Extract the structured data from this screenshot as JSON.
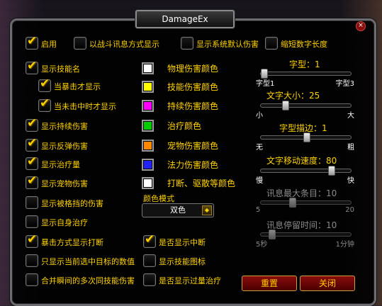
{
  "title": "DamageEx",
  "close_glyph": "×",
  "checkboxes": [
    {
      "label": "启用",
      "checked": true
    },
    {
      "label": "以战斗讯息方式显示",
      "checked": false
    },
    {
      "label": "显示系统默认伤害",
      "checked": false
    },
    {
      "label": "缩短数字长度",
      "checked": false
    },
    {
      "label": "显示技能名",
      "checked": true
    },
    {
      "label": "当暴击才显示",
      "checked": true
    },
    {
      "label": "当未击中时才显示",
      "checked": true
    },
    {
      "label": "显示持续伤害",
      "checked": true
    },
    {
      "label": "显示反弹伤害",
      "checked": true
    },
    {
      "label": "显示治疗量",
      "checked": true
    },
    {
      "label": "显示宠物伤害",
      "checked": true
    },
    {
      "label": "显示被格挡的伤害",
      "checked": false
    },
    {
      "label": "显示自身治疗",
      "checked": false
    },
    {
      "label": "暴击方式显示打断",
      "checked": true
    },
    {
      "label": "是否显示中断",
      "checked": true
    },
    {
      "label": "只显示当前选中目标的数值",
      "checked": false
    },
    {
      "label": "显示技能图标",
      "checked": false
    },
    {
      "label": "合并瞬间的多次同技能伤害",
      "checked": false
    },
    {
      "label": "是否显示过量治疗",
      "checked": false
    }
  ],
  "colors": [
    {
      "label": "物理伤害颜色",
      "color": "#ffffff"
    },
    {
      "label": "技能伤害颜色",
      "color": "#ffff00"
    },
    {
      "label": "持续伤害颜色",
      "color": "#ff00ff"
    },
    {
      "label": "治疗颜色",
      "color": "#00cc00"
    },
    {
      "label": "宠物伤害颜色",
      "color": "#ff8800"
    },
    {
      "label": "法力伤害颜色",
      "color": "#2222ff"
    },
    {
      "label": "打断、驱散等颜色",
      "color": "#ffffff"
    }
  ],
  "color_mode": {
    "label": "颜色模式",
    "value": "双色",
    "arrow": "◆"
  },
  "sliders": {
    "font": {
      "label": "字型：1",
      "value": 1,
      "min": 1,
      "max": 3,
      "min_label": "字型1",
      "max_label": "字型3",
      "enabled": true
    },
    "size": {
      "label": "文字大小：25",
      "value": 25,
      "min": 0,
      "max": 100,
      "min_label": "小",
      "max_label": "大",
      "enabled": true
    },
    "outline": {
      "label": "字型描边：1",
      "value": 1,
      "min": 0,
      "max": 2,
      "min_label": "无",
      "max_label": "粗",
      "enabled": true
    },
    "speed": {
      "label": "文字移动速度：80",
      "value": 80,
      "min": 0,
      "max": 100,
      "min_label": "慢",
      "max_label": "快",
      "enabled": true
    },
    "max_lines": {
      "label": "讯息最大条目：10",
      "value": 10,
      "min": 5,
      "max": 20,
      "min_label": "5",
      "max_label": "20",
      "enabled": false
    },
    "duration": {
      "label": "讯息停留时间：10",
      "value": 10,
      "min": 5,
      "max": 60,
      "min_label": "5秒",
      "max_label": "1分钟",
      "enabled": false
    }
  },
  "buttons": {
    "reset": "重置",
    "close": "关闭"
  }
}
